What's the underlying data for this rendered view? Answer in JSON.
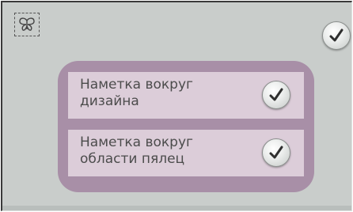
{
  "header": {
    "design_icon": "butterfly-icon",
    "confirm_icon": "checkmark-icon"
  },
  "options": [
    {
      "label_line1": "Наметка вокруг",
      "label_line2": "дизайна",
      "checked": true
    },
    {
      "label_line1": "Наметка вокруг",
      "label_line2": "области пялец",
      "checked": true
    }
  ],
  "colors": {
    "screen_background": "#c9cdcb",
    "panel": "#a88fa7",
    "option_row": "#dccdd9"
  }
}
